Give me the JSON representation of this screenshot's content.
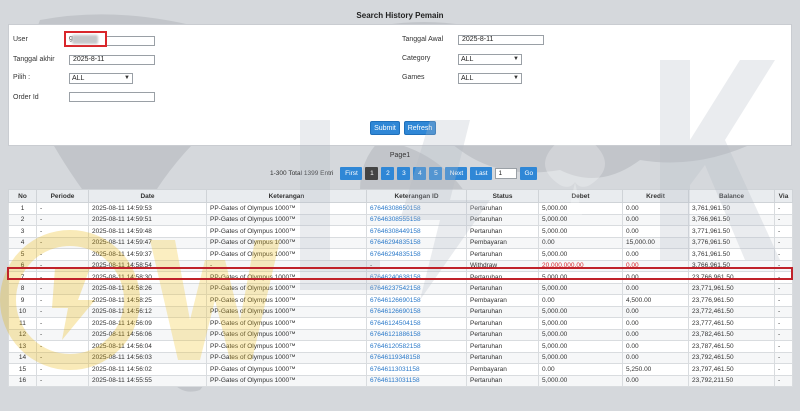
{
  "title": "Search History Pemain",
  "form": {
    "user_label": "User",
    "user_value": "g",
    "tanggal_awal_label": "Tanggal Awal",
    "tanggal_awal_value": "2025-8-11",
    "tanggal_akhir_label": "Tanggal akhir",
    "tanggal_akhir_value": "2025-8-11",
    "category_label": "Category",
    "category_value": "ALL",
    "pilih_label": "Pilih :",
    "pilih_value": "ALL",
    "games_label": "Games",
    "games_value": "ALL",
    "order_id_label": "Order Id",
    "order_id_value": "",
    "submit_label": "Submit",
    "refresh_label": "Refresh"
  },
  "pager": {
    "caption": "Page1",
    "info": "1-300 Total 1399 Entri",
    "first": "First",
    "pages": [
      "1",
      "2",
      "3",
      "4",
      "5"
    ],
    "next": "Next",
    "last": "Last",
    "goto_value": "1",
    "go": "Go"
  },
  "table": {
    "headers": [
      "No",
      "Periode",
      "Date",
      "Keterangan",
      "Keterangan ID",
      "Status",
      "Debet",
      "Kredit",
      "Balance",
      "Via"
    ],
    "rows": [
      [
        "1",
        "-",
        "2025-08-11 14:59:53",
        "PP-Gates of Olympus 1000™",
        "67646308650158",
        "Pertaruhan",
        "5,000.00",
        "0.00",
        "3,761,961.50",
        "-"
      ],
      [
        "2",
        "-",
        "2025-08-11 14:59:51",
        "PP-Gates of Olympus 1000™",
        "67646308555158",
        "Pertaruhan",
        "5,000.00",
        "0.00",
        "3,766,961.50",
        "-"
      ],
      [
        "3",
        "-",
        "2025-08-11 14:59:48",
        "PP-Gates of Olympus 1000™",
        "67646308449158",
        "Pertaruhan",
        "5,000.00",
        "0.00",
        "3,771,961.50",
        "-"
      ],
      [
        "4",
        "-",
        "2025-08-11 14:59:47",
        "PP-Gates of Olympus 1000™",
        "67646294835158",
        "Pembayaran",
        "0.00",
        "15,000.00",
        "3,776,961.50",
        "-"
      ],
      [
        "5",
        "-",
        "2025-08-11 14:59:37",
        "PP-Gates of Olympus 1000™",
        "67646294835158",
        "Pertaruhan",
        "5,000.00",
        "0.00",
        "3,761,961.50",
        "-"
      ],
      [
        "6",
        "-",
        "2025-08-11 14:58:54",
        "-",
        "-",
        "Withdraw",
        "20,000,000.00",
        "0.00",
        "3,766,961.50",
        "-"
      ],
      [
        "7",
        "-",
        "2025-08-11 14:58:30",
        "PP-Gates of Olympus 1000™",
        "67646240638158",
        "Pertaruhan",
        "5,000.00",
        "0.00",
        "23,766,961.50",
        "-"
      ],
      [
        "8",
        "-",
        "2025-08-11 14:58:26",
        "PP-Gates of Olympus 1000™",
        "67646237542158",
        "Pertaruhan",
        "5,000.00",
        "0.00",
        "23,771,961.50",
        "-"
      ],
      [
        "9",
        "-",
        "2025-08-11 14:58:25",
        "PP-Gates of Olympus 1000™",
        "67646126690158",
        "Pembayaran",
        "0.00",
        "4,500.00",
        "23,776,961.50",
        "-"
      ],
      [
        "10",
        "-",
        "2025-08-11 14:56:12",
        "PP-Gates of Olympus 1000™",
        "67646126690158",
        "Pertaruhan",
        "5,000.00",
        "0.00",
        "23,772,461.50",
        "-"
      ],
      [
        "11",
        "-",
        "2025-08-11 14:56:09",
        "PP-Gates of Olympus 1000™",
        "67646124504158",
        "Pertaruhan",
        "5,000.00",
        "0.00",
        "23,777,461.50",
        "-"
      ],
      [
        "12",
        "-",
        "2025-08-11 14:56:06",
        "PP-Gates of Olympus 1000™",
        "67646121886158",
        "Pertaruhan",
        "5,000.00",
        "0.00",
        "23,782,461.50",
        "-"
      ],
      [
        "13",
        "-",
        "2025-08-11 14:56:04",
        "PP-Gates of Olympus 1000™",
        "67646120582158",
        "Pertaruhan",
        "5,000.00",
        "0.00",
        "23,787,461.50",
        "-"
      ],
      [
        "14",
        "-",
        "2025-08-11 14:56:03",
        "PP-Gates of Olympus 1000™",
        "67646119348158",
        "Pertaruhan",
        "5,000.00",
        "0.00",
        "23,792,461.50",
        "-"
      ],
      [
        "15",
        "-",
        "2025-08-11 14:56:02",
        "PP-Gates of Olympus 1000™",
        "67646113031158",
        "Pembayaran",
        "0.00",
        "5,250.00",
        "23,797,461.50",
        "-"
      ],
      [
        "16",
        "-",
        "2025-08-11 14:55:55",
        "PP-Gates of Olympus 1000™",
        "67646113031158",
        "Pertaruhan",
        "5,000.00",
        "0.00",
        "23,792,211.50",
        "-"
      ]
    ]
  },
  "colors": {
    "accent": "#2f87d6",
    "highlight": "#c0222a",
    "link": "#2a79c9"
  },
  "icons": {
    "watermark": "spade-logo-icon",
    "background": "world-map-icon"
  }
}
